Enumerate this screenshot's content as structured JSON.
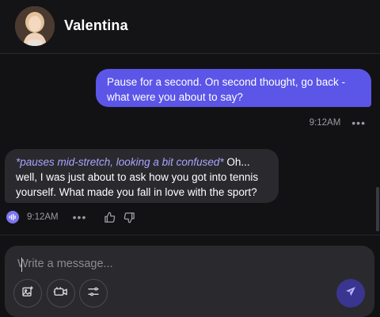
{
  "header": {
    "contact_name": "Valentina",
    "avatar_icon": "user-avatar-photo"
  },
  "messages": [
    {
      "role": "user",
      "text": "Pause for a second. On second thought, go back - what were you about to say?",
      "time": "9:12AM",
      "more_icon": "more-horizontal-icon"
    },
    {
      "role": "assistant",
      "action": "*pauses mid-stretch, looking a bit confused*",
      "text": " Oh... well, I was just about to ask how you got into tennis yourself. What made you fall in love with the sport?",
      "time": "9:12AM",
      "icons": [
        "audio-wave-icon",
        "more-horizontal-icon",
        "thumbs-up-icon",
        "thumbs-down-icon"
      ]
    }
  ],
  "composer": {
    "placeholder": "Write a message...",
    "value": "",
    "tools": [
      "image-icon",
      "video-icon",
      "sliders-icon"
    ],
    "send_icon": "send-icon"
  },
  "colors": {
    "user_bubble": "#5b55e8",
    "assistant_bubble": "#2a2a2e",
    "action_text": "#a9a3ff",
    "background": "#121214",
    "send_button": "#3a3590"
  }
}
